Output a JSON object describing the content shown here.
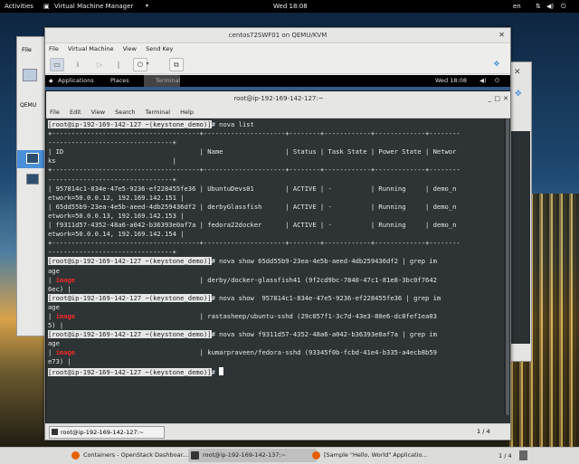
{
  "topbar": {
    "activities": "Activities",
    "app": "Virtual Machine Manager",
    "clock": "Wed 18:08",
    "locale": "en"
  },
  "vmm": {
    "menu_fragment": "File",
    "label_fragment": "QEMU"
  },
  "guest_window": {
    "title": "centos72SWF01 on QEMU/KVM",
    "menu": [
      "File",
      "Virtual Machine",
      "View",
      "Send Key"
    ]
  },
  "guest_top": {
    "applications": "Applications",
    "places": "Places",
    "terminal": "Terminal",
    "clock": "Wed 18:08"
  },
  "terminal": {
    "title": "root@ip-192-169-142-127:~",
    "menu": [
      "File",
      "Edit",
      "View",
      "Search",
      "Terminal",
      "Help"
    ],
    "lines": [
      {
        "t": "[root@ip-192-169-142-127 ~(keystone_demo)]# nova list"
      },
      {
        "t": "+--------------------------------------+---------------------+--------+------------+-------------+--------"
      },
      {
        "t": "--------------------------------+"
      },
      {
        "t": "| ID                                   | Name                | Status | Task State | Power State | Networ"
      },
      {
        "t": "ks                              |"
      },
      {
        "t": "+--------------------------------------+---------------------+--------+------------+-------------+--------"
      },
      {
        "t": "--------------------------------+"
      },
      {
        "t": "| 957814c1-834e-47e5-9236-ef228455fe36 | UbuntuDevs01        | ACTIVE | -          | Running     | demo_n"
      },
      {
        "t": "etwork=50.0.0.12, 192.169.142.151 |"
      },
      {
        "t": "| 65dd55b9-23ea-4e5b-aeed-4db259436df2 | derbyGlassfish      | ACTIVE | -          | Running     | demo_n"
      },
      {
        "t": "etwork=50.0.0.13, 192.169.142.153 |"
      },
      {
        "t": "| f9311d57-4352-48a6-a042-b36393e0af7a | fedora22docker      | ACTIVE | -          | Running     | demo_n"
      },
      {
        "t": "etwork=50.0.0.14, 192.169.142.154 |"
      },
      {
        "t": "+--------------------------------------+---------------------+--------+------------+-------------+--------"
      },
      {
        "t": "--------------------------------+"
      },
      {
        "t": "[root@ip-192-169-142-127 ~(keystone_demo)]# nova show 65dd55b9-23ea-4e5b-aeed-4db259436df2 | grep im"
      },
      {
        "t": "age"
      },
      {
        "p": "| ",
        "r": "image",
        "s": "                                | derby/docker-glassfish41 (9f2cd9bc-7840-47c1-81e8-3bc0f7642"
      },
      {
        "t": "6ec) |"
      },
      {
        "t": "[root@ip-192-169-142-127 ~(keystone_demo)]# nova show  957814c1-834e-47e5-9236-ef228455fe36 | grep im"
      },
      {
        "t": "age"
      },
      {
        "p": "| ",
        "r": "image",
        "s": "                                | rastasheep/ubuntu-sshd (29c057f1-3c7d-43e3-80e6-dc8fef1ea03"
      },
      {
        "t": "5) |"
      },
      {
        "t": "[root@ip-192-169-142-127 ~(keystone_demo)]# nova show f9311d57-4352-48a6-a042-b36393e0af7a | grep im"
      },
      {
        "t": "age"
      },
      {
        "p": "| ",
        "r": "image",
        "s": "                                | kumarpraveen/fedora-sshd (93345f0b-fcbd-41e4-b335-a4ecb8b59"
      },
      {
        "t": "e73) |"
      },
      {
        "t": "[root@ip-192-169-142-127 ~(keystone_demo)]# ",
        "cursor": true
      }
    ]
  },
  "guest_bottom": {
    "task": "root@ip-192-169-142-127:~",
    "pager": "1 / 4"
  },
  "taskbar": {
    "items": [
      "Containers - OpenStack Dashboar...",
      "root@ip-192-169-142-137:~",
      "[Sample \"Hello, World\" Applicatio..."
    ],
    "pager": "1 / 4"
  },
  "colors": {
    "terminal_bg": "#2e3436",
    "prompt_highlight": "#e6e6e6",
    "grep_match": "#ef2929"
  }
}
